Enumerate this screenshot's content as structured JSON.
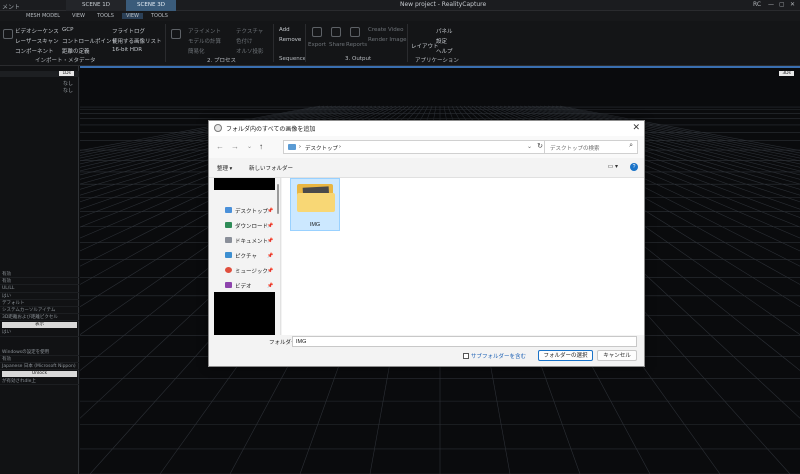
{
  "titlebar": {
    "logo": "メント",
    "tab1": "SCENE 1D",
    "tab2": "SCENE 3D",
    "title": "New project - RealityCapture",
    "user": "RC",
    "controls": [
      "—",
      "▢",
      "✕"
    ]
  },
  "menubar": {
    "items": [
      "MESH MODEL",
      "VIEW",
      "TOOLS",
      "VIEW",
      "TOOLS"
    ]
  },
  "ribbon": {
    "import": {
      "col1": [
        "ビデオシーケンス",
        "レーザースキャン",
        "コンポーネント"
      ],
      "col2": [
        "GCP",
        "コントロールポイント",
        "距離の定義"
      ],
      "col3": [
        "フライトログ",
        "使用する画像リスト",
        "16-bit HDR"
      ],
      "group": "インポート・メタデータ"
    },
    "process": {
      "col1": [
        "アライメント",
        "モデルの計算",
        "簡易化"
      ],
      "col2": [
        "テクスチャ",
        "色付け",
        "オルソ投影"
      ],
      "group": "2. プロセス"
    },
    "sequence": {
      "add": "Add",
      "remove": "Remove",
      "group": "Sequence"
    },
    "output": {
      "items": [
        "Export",
        "Share",
        "Reports"
      ],
      "create_video": "Create Video",
      "render_image": "Render Image",
      "group": "3. Output"
    },
    "application": {
      "layout": "レイアウト",
      "panel": "パネル",
      "settings": "設定",
      "help": "ヘルプ",
      "group": "アプリケーション"
    }
  },
  "leftpanel": {
    "badge": "1Ds",
    "top_text": [
      "なし",
      "なし"
    ],
    "rows": [
      "有効",
      "有効",
      "UL/LL",
      "はい",
      "デフォルト",
      "システムカーソルアイテム",
      "3D距離および距離ピクセル",
      "はい"
    ],
    "button1": "表示",
    "rows2": [
      "Windowsの設定を使用",
      "有効",
      "Japanese 日本 (Microsoft Nippon)"
    ],
    "button2": "Unlock",
    "footer": "が有効されdle上"
  },
  "viewport": {
    "badge": "3Ds"
  },
  "dialog": {
    "title": "フォルダ内のすべての画像を追加",
    "address": {
      "crumbs": [
        "›",
        "デスクトップ",
        "›"
      ]
    },
    "search_placeholder": "デスクトップの検索",
    "cmd": {
      "organize": "整理 ▾",
      "new_folder": "新しいフォルダー",
      "help": "?"
    },
    "nav_items": [
      {
        "label": "デスクトップ",
        "color": "#4a90d9"
      },
      {
        "label": "ダウンロード",
        "color": "#2e8b57"
      },
      {
        "label": "ドキュメント",
        "color": "#8a8f99"
      },
      {
        "label": "ピクチャ",
        "color": "#3d8fd1"
      },
      {
        "label": "ミュージック",
        "color": "#e04f3e"
      },
      {
        "label": "ビデオ",
        "color": "#8e44ad"
      }
    ],
    "file": {
      "name": "IMG"
    },
    "folder_label": "フォルダー:",
    "folder_value": "IMG",
    "subfolders": "サブフォルダーを含む",
    "select_button": "フォルダーの選択",
    "cancel_button": "キャンセル"
  }
}
